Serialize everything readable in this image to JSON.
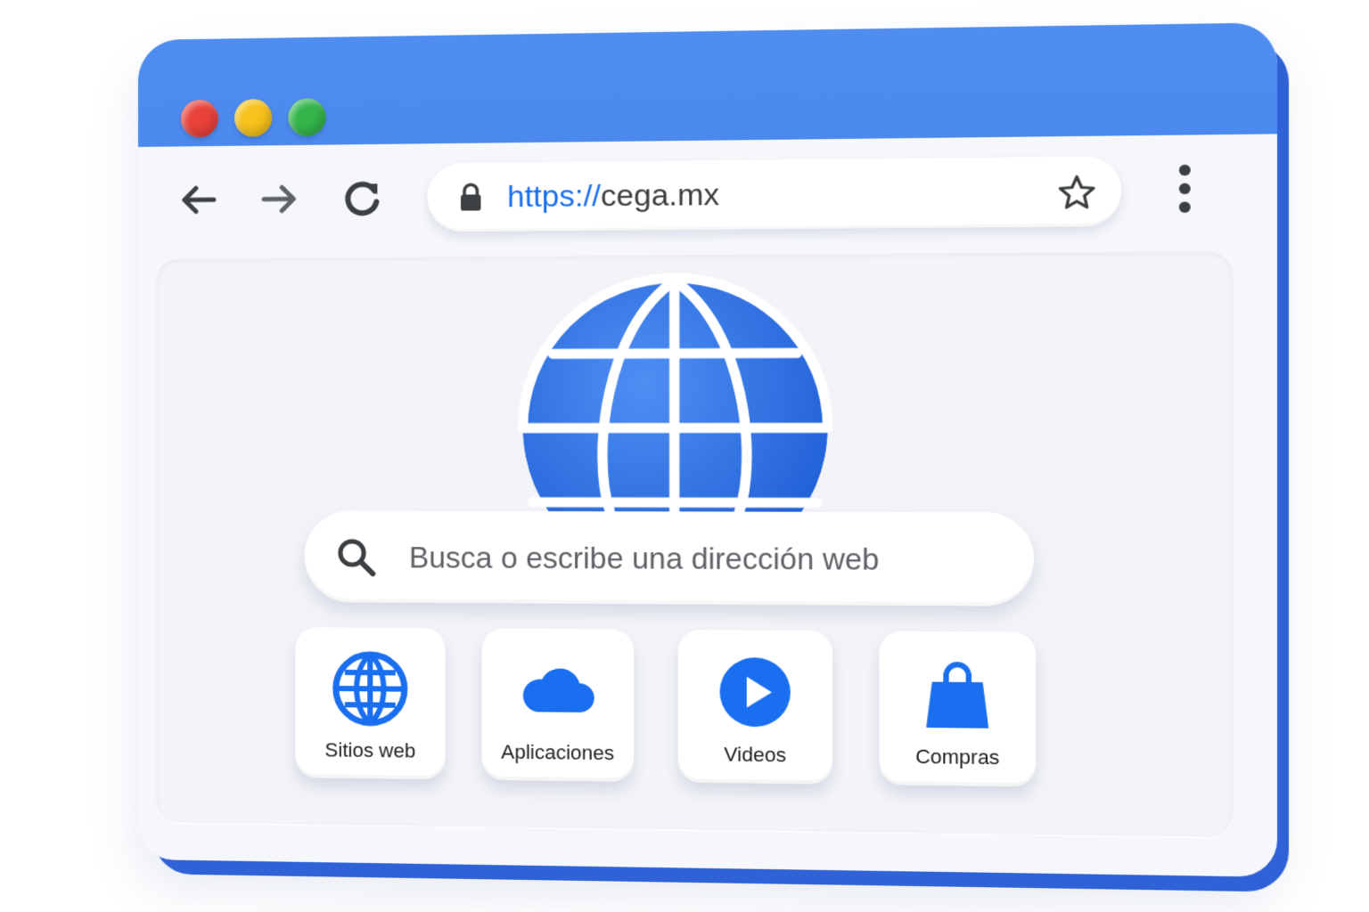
{
  "window": {
    "traffic_lights": [
      "close",
      "minimize",
      "maximize"
    ],
    "colors": {
      "frame": "#3b7be8",
      "accent": "#1a6ff0",
      "close": "#e9423a",
      "minimize": "#f6c21b",
      "maximize": "#34b54a"
    }
  },
  "toolbar": {
    "back_icon": "arrow-left-icon",
    "forward_icon": "arrow-right-icon",
    "reload_icon": "reload-icon",
    "menu_icon": "more-vertical-icon"
  },
  "address_bar": {
    "lock_icon": "lock-icon",
    "url_scheme": "https://",
    "url_host": "cega.mx",
    "bookmark_icon": "star-icon"
  },
  "content": {
    "hero_icon": "globe-icon",
    "search": {
      "icon": "search-icon",
      "placeholder": "Busca o escribe una dirección web"
    },
    "shortcuts": [
      {
        "label": "Sitios web",
        "icon": "globe-icon"
      },
      {
        "label": "Aplicaciones",
        "icon": "cloud-icon"
      },
      {
        "label": "Videos",
        "icon": "play-icon"
      },
      {
        "label": "Compras",
        "icon": "shopping-bag-icon"
      }
    ]
  }
}
